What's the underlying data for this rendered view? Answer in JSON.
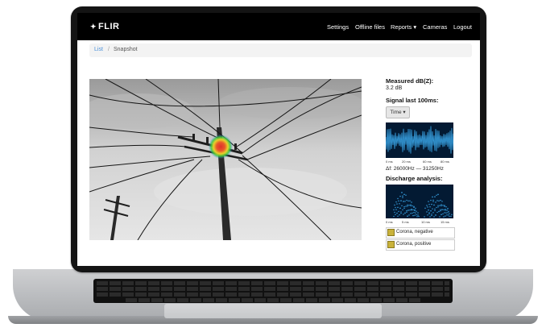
{
  "navbar": {
    "brand": "FLIR",
    "items": [
      {
        "label": "Settings"
      },
      {
        "label": "Offline files"
      },
      {
        "label": "Reports ▾"
      },
      {
        "label": "Cameras"
      },
      {
        "label": "Logout"
      }
    ]
  },
  "breadcrumb": {
    "list": "List",
    "separator": "/",
    "current": "Snapshot"
  },
  "panel": {
    "measured_title": "Measured dB(Z):",
    "measured_value": "3.2 dB",
    "signal_title": "Signal last 100ms:",
    "time_button": "Time ▾",
    "signal_ticks": [
      "0 ms",
      "20 ms",
      "60 ms",
      "80 ms"
    ],
    "frequency_range": "Δf: 26000Hz — 31250Hz",
    "discharge_title": "Discharge analysis:",
    "discharge_ticks": [
      "0 ms",
      "5 ms",
      "10 ms",
      "15 ms"
    ],
    "results": [
      {
        "label": "Corona, negative"
      },
      {
        "label": "Corona, positive"
      }
    ]
  },
  "colors": {
    "navbar_bg": "#000000",
    "link": "#4a90d9",
    "plot_bg": "#031a33",
    "signal": "#3aa6e8",
    "heat_hot": "#e0302a",
    "heat_ring": "#3cc63c"
  }
}
